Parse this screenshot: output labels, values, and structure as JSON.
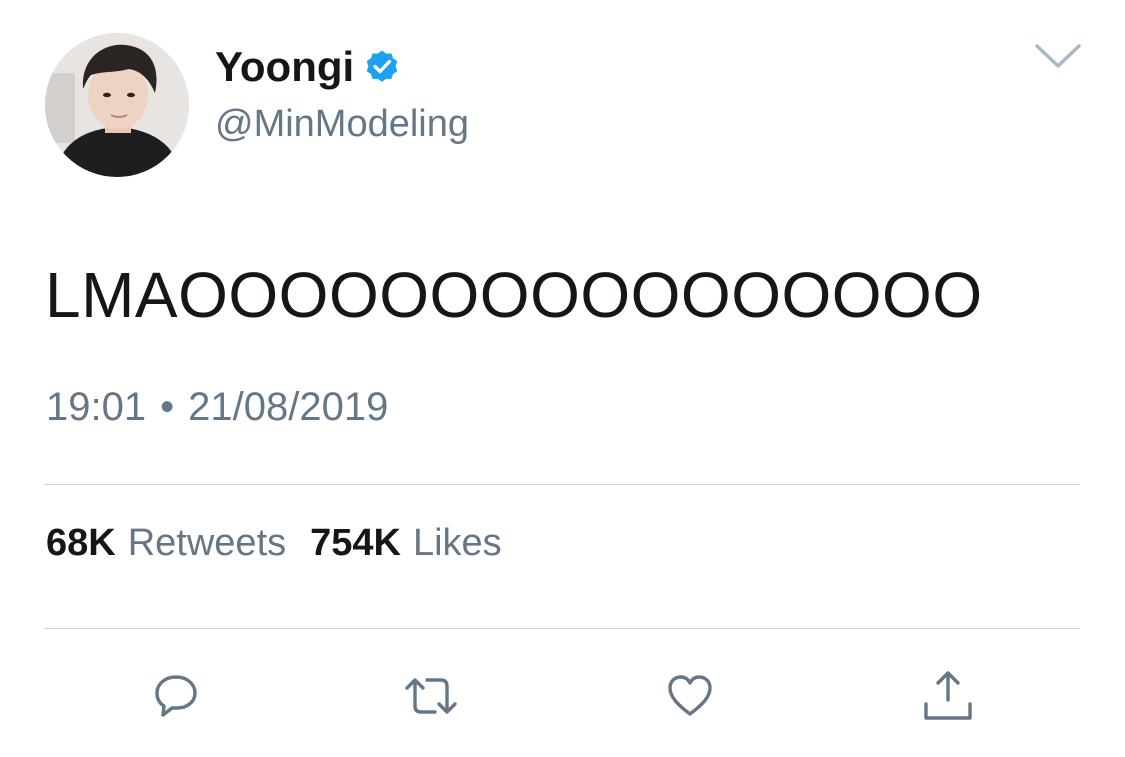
{
  "user": {
    "display_name": "Yoongi",
    "handle": "@MinModeling",
    "verified": true,
    "avatar_icon": "profile-photo"
  },
  "tweet": {
    "text": "LMAOOOOOOOOOOOOOOOO",
    "time": "19:01",
    "separator": "•",
    "date": "21/08/2019"
  },
  "stats": {
    "retweets_count": "68K",
    "retweets_label": "Retweets",
    "likes_count": "754K",
    "likes_label": "Likes"
  },
  "actions": [
    {
      "name": "reply",
      "icon": "speech-bubble-icon"
    },
    {
      "name": "retweet",
      "icon": "retweet-arrows-icon"
    },
    {
      "name": "like",
      "icon": "heart-icon"
    },
    {
      "name": "share",
      "icon": "share-upload-icon"
    }
  ],
  "colors": {
    "text_primary": "#14171a",
    "text_secondary": "#657786",
    "verified_blue": "#1da1f2",
    "divider": "#ccd6dd",
    "icon_gray": "#657786"
  }
}
